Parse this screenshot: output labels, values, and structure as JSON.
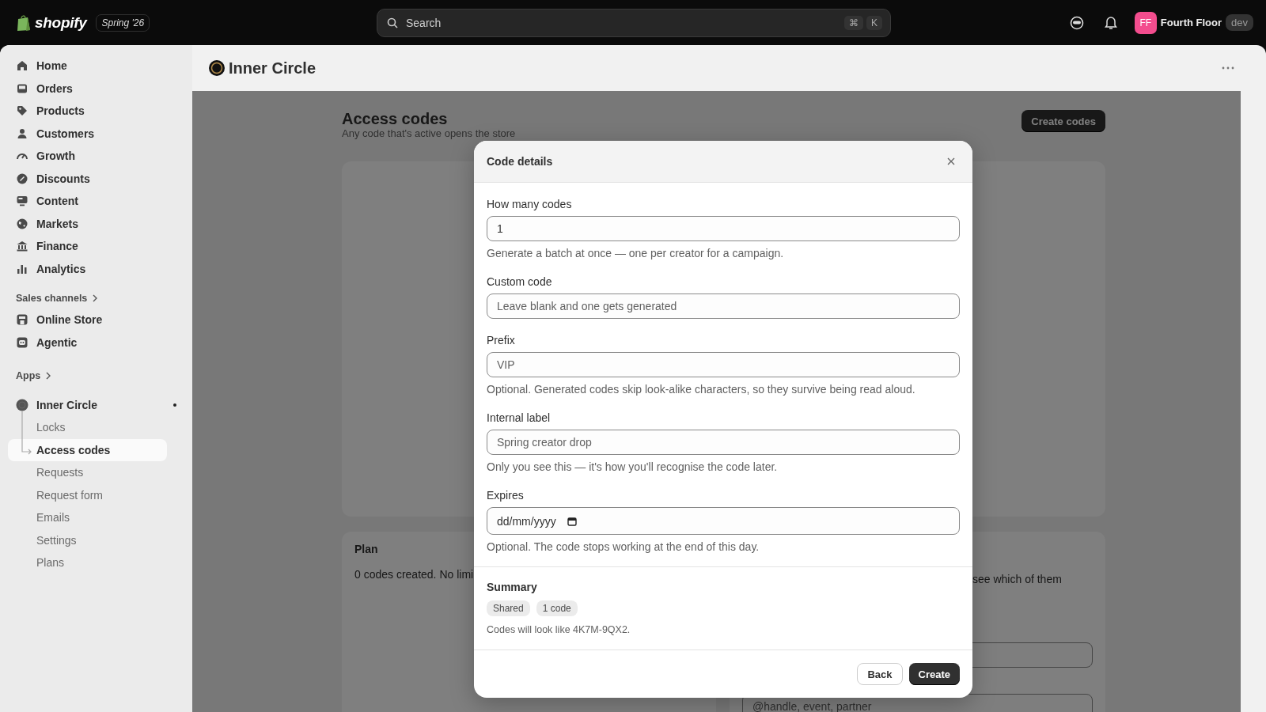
{
  "topbar": {
    "logo_text": "shopify",
    "edition": "Spring '26",
    "search": {
      "placeholder": "Search"
    },
    "shortcut_keys": [
      "⌘",
      "K"
    ],
    "store": {
      "initials": "FF",
      "name": "Fourth Floor",
      "badge": "dev"
    }
  },
  "sidebar": {
    "items": [
      {
        "label": "Home",
        "selected": false
      },
      {
        "label": "Orders",
        "selected": false
      },
      {
        "label": "Products",
        "selected": false
      },
      {
        "label": "Customers",
        "selected": false
      },
      {
        "label": "Growth",
        "selected": false
      },
      {
        "label": "Discounts",
        "selected": false
      },
      {
        "label": "Content",
        "selected": false
      },
      {
        "label": "Markets",
        "selected": false
      },
      {
        "label": "Finance",
        "selected": false
      },
      {
        "label": "Analytics",
        "selected": false
      }
    ],
    "sales_channels": {
      "heading": "Sales channels",
      "items": [
        {
          "label": "Online Store",
          "selected": false
        },
        {
          "label": "Agentic",
          "selected": false
        }
      ]
    },
    "apps": {
      "heading": "Apps",
      "app": {
        "label": "Inner Circle",
        "children": [
          {
            "label": "Locks",
            "selected": false
          },
          {
            "label": "Access codes",
            "selected": true
          },
          {
            "label": "Requests",
            "selected": false
          },
          {
            "label": "Request form",
            "selected": false
          },
          {
            "label": "Emails",
            "selected": false
          },
          {
            "label": "Settings",
            "selected": false
          },
          {
            "label": "Plans",
            "selected": false
          }
        ]
      }
    }
  },
  "page_header": {
    "title": "Inner Circle"
  },
  "page": {
    "title": "Access codes",
    "subtitle": "Any code that's active opens the store",
    "primary_action": "Create codes",
    "plan_card": {
      "title": "Plan",
      "text": "0 codes created. No limi"
    },
    "side_card": {
      "text": "see which of them",
      "field_placeholder": "@handle, event, partner"
    }
  },
  "modal": {
    "title": "Code details",
    "fields": [
      {
        "label": "How many codes",
        "kind": "text",
        "value": "1",
        "help": "Generate a batch at once — one per creator for a campaign."
      },
      {
        "label": "Custom code",
        "kind": "text",
        "placeholder": "Leave blank and one gets generated"
      },
      {
        "label": "Prefix",
        "kind": "text",
        "placeholder": "VIP",
        "help": "Optional. Generated codes skip look-alike characters, so they survive being read aloud."
      },
      {
        "label": "Internal label",
        "kind": "text",
        "placeholder": "Spring creator drop",
        "help": "Only you see this — it's how you'll recognise the code later."
      },
      {
        "label": "Expires",
        "kind": "date",
        "placeholder": "dd/mm/yyyy",
        "help": "Optional. The code stops working at the end of this day."
      }
    ],
    "summary": {
      "title": "Summary",
      "chips": [
        "Shared",
        "1 code"
      ],
      "text": "Codes will look like 4K7M-9QX2."
    },
    "buttons": [
      {
        "label": "Back",
        "kind": "secondary"
      },
      {
        "label": "Create",
        "kind": "primary"
      }
    ]
  }
}
